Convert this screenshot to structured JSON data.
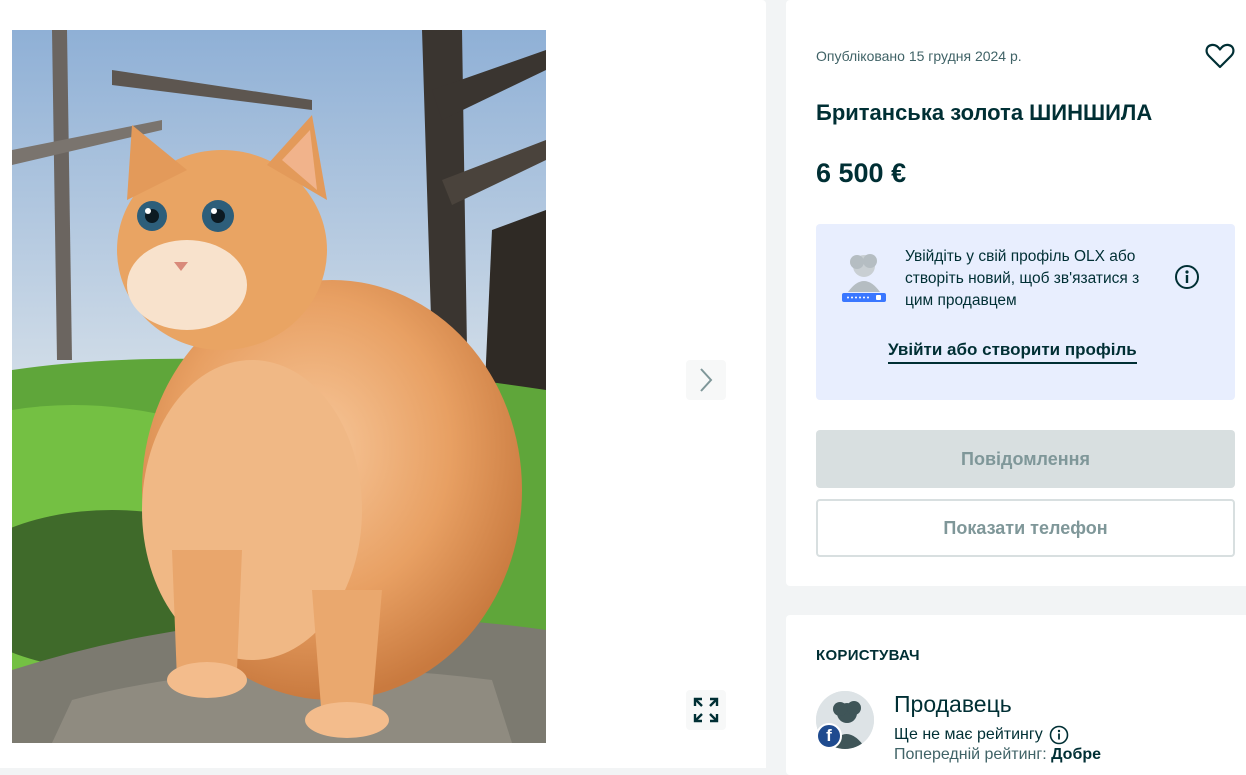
{
  "listing": {
    "published": "Опубліковано 15 грудня 2024 р.",
    "title": "Британська золота ШИНШИЛА",
    "price": "6 500 €"
  },
  "login_prompt": {
    "text": "Увійдіть у свій профіль OLX або створіть новий, щоб зв'язатися з цим продавцем",
    "link": "Увійти або створити профіль"
  },
  "actions": {
    "message": "Повідомлення",
    "show_phone": "Показати телефон"
  },
  "user": {
    "heading": "КОРИСТУВАЧ",
    "name": "Продавець",
    "no_rating": "Ще не має рейтингу",
    "prev_rating_label": "Попередній рейтинг: ",
    "prev_rating_value": "Добре",
    "badge": "f"
  },
  "icons": {
    "favorite": "heart-icon",
    "next": "chevron-right-icon",
    "expand": "expand-icon",
    "info": "info-icon"
  },
  "colors": {
    "brand_dark": "#002f34",
    "login_bg": "#e8eefe",
    "disabled_btn": "#d8dfe0"
  }
}
